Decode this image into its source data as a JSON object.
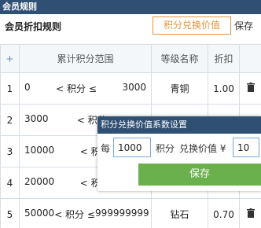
{
  "window": {
    "title": "会员规则"
  },
  "header": {
    "title": "会员折扣规则",
    "exchange_button": "积分兑换价值",
    "save_label": "保存"
  },
  "table": {
    "columns": [
      "+",
      "累计积分范围",
      "等级名称",
      "折扣",
      ""
    ],
    "range_connector": "< 积分 ≤",
    "rows": [
      {
        "no": "1",
        "min": "0",
        "max": "3000",
        "level": "青铜",
        "discount": "1.00"
      },
      {
        "no": "2",
        "min": "3000",
        "max": "",
        "level": "",
        "discount": ""
      },
      {
        "no": "3",
        "min": "10000",
        "max": "",
        "level": "",
        "discount": ""
      },
      {
        "no": "4",
        "min": "20000",
        "max": "",
        "level": "",
        "discount": ""
      },
      {
        "no": "5",
        "min": "50000",
        "max": "999999999",
        "level": "钻石",
        "discount": "0.70"
      }
    ]
  },
  "dialog": {
    "title": "积分兑换价值系数设置",
    "prefix": "每",
    "points_value": "1000",
    "points_unit": "积分",
    "worth_label": "兑换价值 ¥",
    "worth_value": "10",
    "save_button": "保存"
  },
  "colors": {
    "title_bar": "#2f4f73",
    "accent_orange": "#e8923a",
    "save_green": "#6ab04c"
  }
}
